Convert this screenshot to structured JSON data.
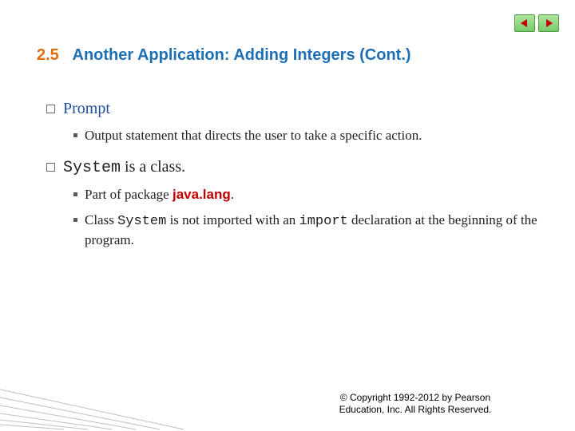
{
  "title": {
    "num": "2.5",
    "text": "Another Application: Adding Integers (Cont.)"
  },
  "bullets": {
    "b1": {
      "label": "Prompt"
    },
    "b1_sub1": "Output statement that directs the user to take a specific action.",
    "b2": {
      "code": "System",
      "rest": " is a class."
    },
    "b2_sub1": {
      "pre": "Part of package ",
      "javalang": "java.lang",
      "post": "."
    },
    "b2_sub2": {
      "pre": "Class ",
      "code1": "System",
      "mid": " is not imported with an ",
      "code2": "import",
      "post": " declaration at the beginning of the program."
    }
  },
  "footer": {
    "line1": "© Copyright 1992-2012 by Pearson",
    "line2": "Education, Inc. All Rights Reserved."
  }
}
